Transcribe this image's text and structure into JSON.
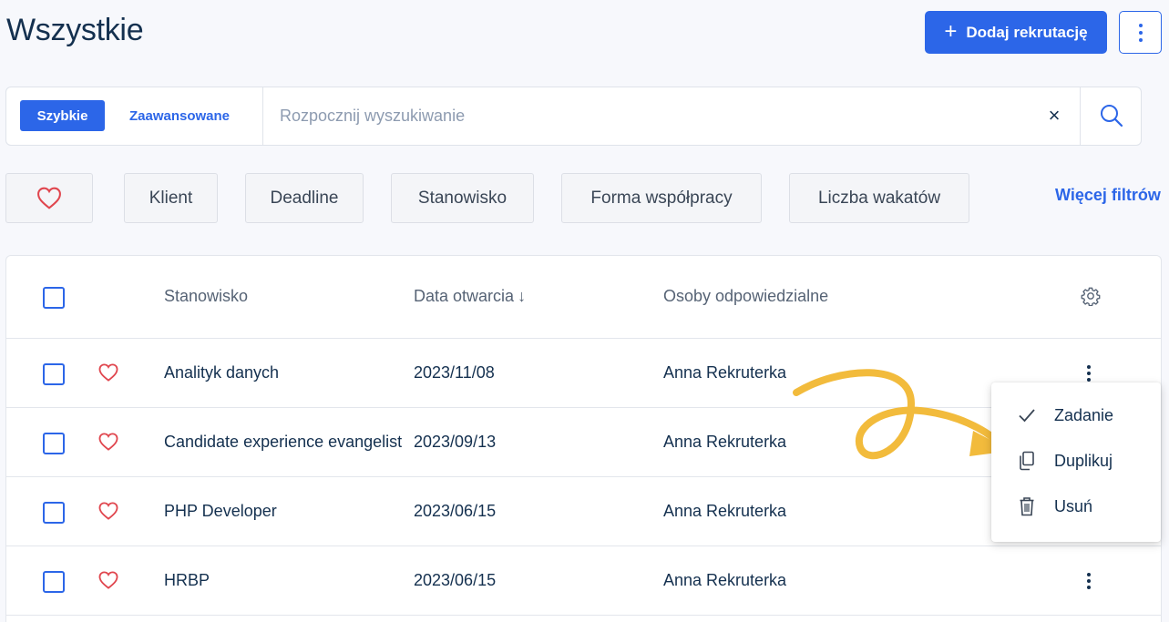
{
  "page": {
    "title": "Wszystkie"
  },
  "header": {
    "add_button_label": "Dodaj rekrutację",
    "add_button_plus": "+"
  },
  "search": {
    "mode_quick": "Szybkie",
    "mode_advanced": "Zaawansowane",
    "placeholder": "Rozpocznij wyszukiwanie",
    "value": "",
    "clear_glyph": "×"
  },
  "filters": {
    "chips": [
      "Klient",
      "Deadline",
      "Stanowisko",
      "Forma współpracy",
      "Liczba wakatów"
    ],
    "more_label": "Więcej filtrów"
  },
  "table": {
    "columns": {
      "position": "Stanowisko",
      "opened": "Data otwarcia",
      "sort_glyph": "↓",
      "responsible": "Osoby odpowiedzialne"
    },
    "rows": [
      {
        "position": "Analityk danych",
        "opened": "2023/11/08",
        "responsible": "Anna Rekruterka"
      },
      {
        "position": "Candidate experience evangelist",
        "opened": "2023/09/13",
        "responsible": "Anna Rekruterka"
      },
      {
        "position": "PHP Developer",
        "opened": "2023/06/15",
        "responsible": "Anna Rekruterka"
      },
      {
        "position": "HRBP",
        "opened": "2023/06/15",
        "responsible": "Anna Rekruterka"
      }
    ]
  },
  "context_menu": {
    "items": [
      {
        "label": "Zadanie",
        "icon": "check-icon"
      },
      {
        "label": "Duplikuj",
        "icon": "copy-icon"
      },
      {
        "label": "Usuń",
        "icon": "trash-icon"
      }
    ]
  },
  "colors": {
    "accent": "#2c66e8",
    "heart": "#e0464e",
    "annotation_arrow": "#f2bb3c"
  }
}
